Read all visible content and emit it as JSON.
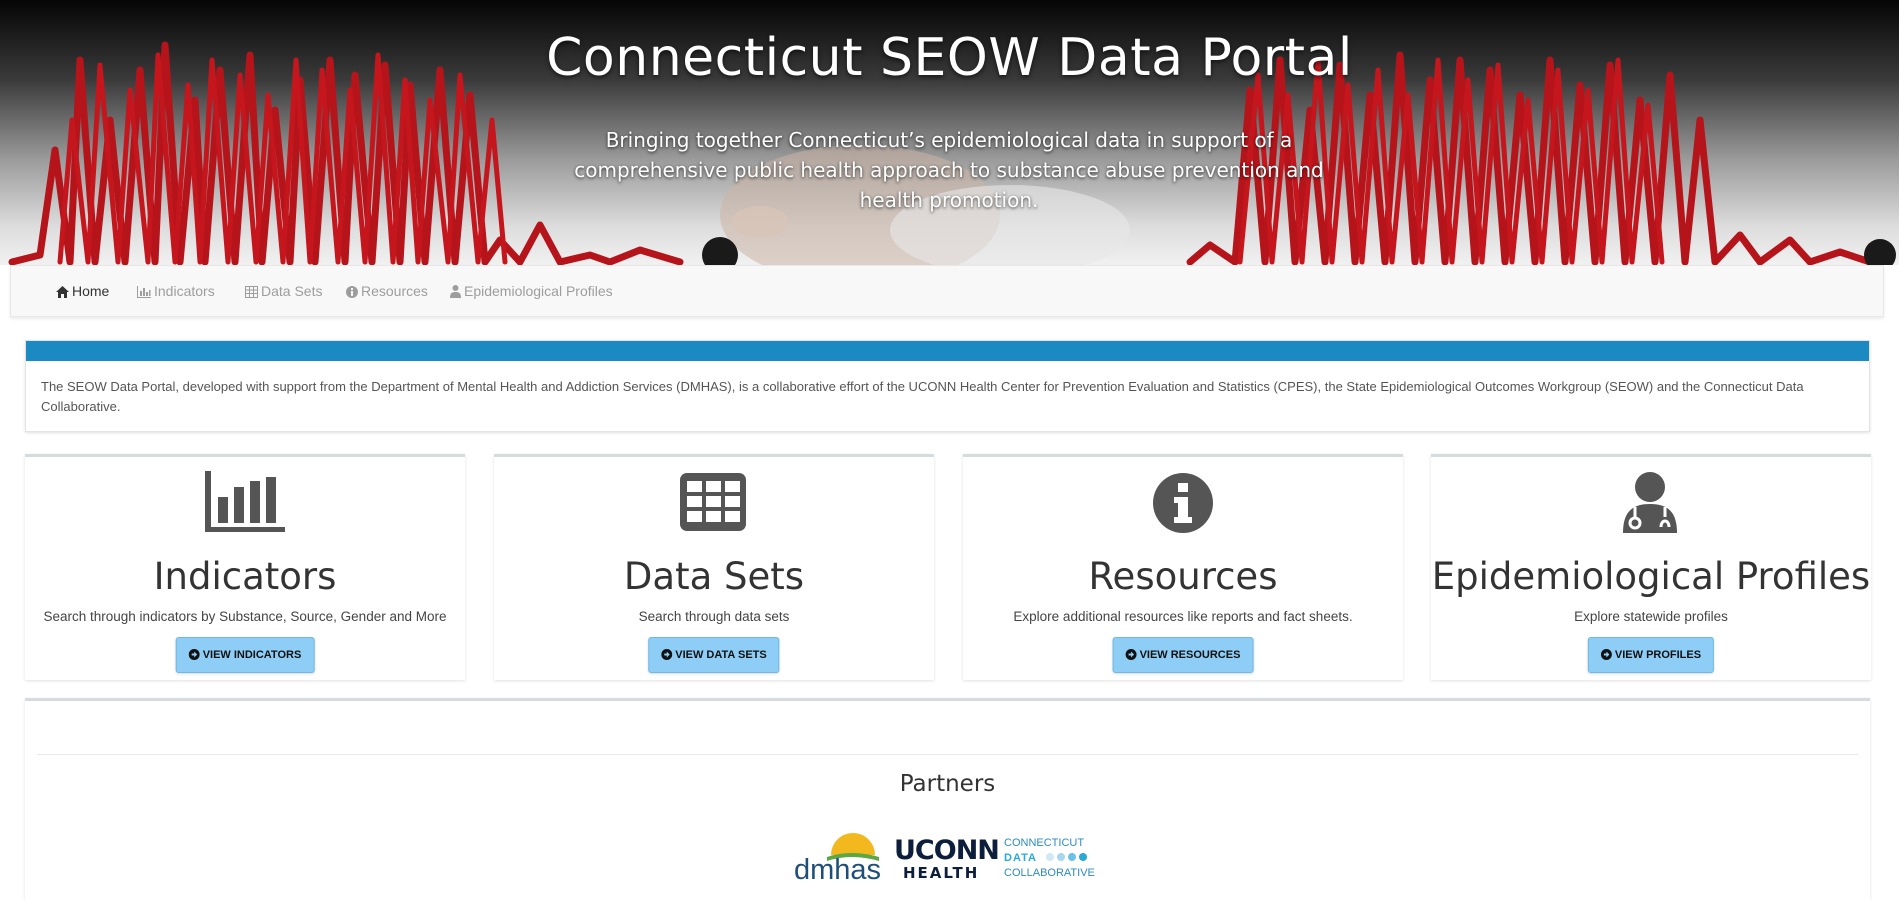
{
  "hero": {
    "title": "Connecticut SEOW Data Portal",
    "subtitle": "Bringing together Connecticut’s epidemiological data in support of a comprehensive public health approach to substance abuse prevention and health promotion."
  },
  "nav": {
    "items": [
      {
        "label": "Home",
        "icon": "home-icon",
        "active": true
      },
      {
        "label": "Indicators",
        "icon": "bar-chart-icon",
        "active": false
      },
      {
        "label": "Data Sets",
        "icon": "table-icon",
        "active": false
      },
      {
        "label": "Resources",
        "icon": "info-icon",
        "active": false
      },
      {
        "label": "Epidemiological Profiles",
        "icon": "user-md-icon",
        "active": false
      }
    ]
  },
  "info": {
    "text": "The SEOW Data Portal, developed with support from the Department of Mental Health and Addiction Services (DMHAS), is a collaborative effort of the UCONN Health Center for Prevention Evaluation and Statistics (CPES), the State Epidemiological Outcomes Workgroup (SEOW) and the Connecticut Data Collaborative.",
    "bar_color": "#1b8ac3"
  },
  "cards": [
    {
      "title": "Indicators",
      "description": "Search through indicators by Substance, Source, Gender and More",
      "button": "VIEW INDICATORS",
      "icon": "bar-chart-icon"
    },
    {
      "title": "Data Sets",
      "description": "Search through data sets",
      "button": "VIEW DATA SETS",
      "icon": "table-icon"
    },
    {
      "title": "Resources",
      "description": "Explore additional resources like reports and fact sheets.",
      "button": "VIEW RESOURCES",
      "icon": "info-circle-icon"
    },
    {
      "title": "Epidemiological Profiles",
      "description": "Explore statewide profiles",
      "button": "VIEW PROFILES",
      "icon": "user-md-icon"
    }
  ],
  "partners": {
    "title": "Partners",
    "logos": [
      {
        "name": "dmhas",
        "text": "dmhas"
      },
      {
        "name": "uconn-health",
        "text_top": "UCONN",
        "text_bottom": "HEALTH"
      },
      {
        "name": "connecticut-data-collaborative",
        "line1": "CONNECTICUT",
        "line2": "DATA",
        "line3": "COLLABORATIVE"
      }
    ]
  },
  "colors": {
    "accent": "#1b8ac3",
    "button": "#8ecdf5",
    "ecg_red": "#c4161c"
  }
}
